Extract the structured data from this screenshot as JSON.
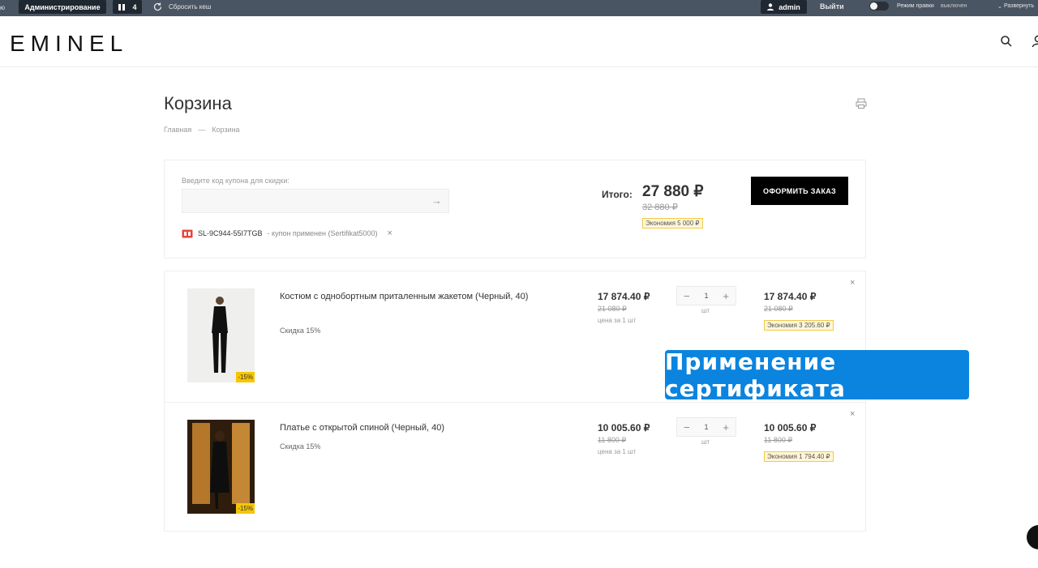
{
  "adminbar": {
    "lead": "ю",
    "admin_label": "Администрирование",
    "count_label": "4",
    "reset_cache": "Сбросить кеш",
    "user": "admin",
    "logout": "Выйти",
    "edit_mode": "Режим правки",
    "edit_state": "выключен",
    "expand": "Развернуть"
  },
  "header": {
    "logo": "EMINEL"
  },
  "page": {
    "title": "Корзина",
    "breadcrumb_home": "Главная",
    "breadcrumb_sep": "—",
    "breadcrumb_current": "Корзина"
  },
  "coupon": {
    "label": "Введите код купона для скидки:",
    "input_value": "",
    "applied_code": "SL-9C944-55I7TGB",
    "applied_text": "- купон применен (Sertifikat5000)",
    "remove": "×"
  },
  "totals": {
    "label": "Итого:",
    "sum": "27 880 ₽",
    "old_sum": "32 880 ₽",
    "saving": "Экономия 5 000 ₽",
    "checkout": "ОФОРМИТЬ ЗАКАЗ"
  },
  "items": [
    {
      "name": "Костюм с однобортным приталенным жакетом (Черный, 40)",
      "discount": "Скидка 15%",
      "badge": "-15%",
      "price": "17 874.40 ₽",
      "old_price": "21 080 ₽",
      "per_unit": "цена за 1 шт",
      "qty": "1",
      "unit": "шт",
      "total": "17 874.40 ₽",
      "total_old": "21 080 ₽",
      "saving": "Экономия 3 205.60 ₽",
      "remove": "×"
    },
    {
      "name": "Платье с открытой спиной (Черный, 40)",
      "discount": "Скидка 15%",
      "badge": "-15%",
      "price": "10 005.60 ₽",
      "old_price": "11 800 ₽",
      "per_unit": "цена за 1 шт",
      "qty": "1",
      "unit": "шт",
      "total": "10 005.60 ₽",
      "total_old": "11 800 ₽",
      "saving": "Экономия 1 794.40 ₽",
      "remove": "×"
    }
  ],
  "overlay": {
    "caption": "Применение сертификата"
  },
  "colors": {
    "adminbar": "#4a5563",
    "accent_banner": "#0a84df",
    "saving_badge": "#fff6d6",
    "sale_badge": "#f7c600"
  }
}
